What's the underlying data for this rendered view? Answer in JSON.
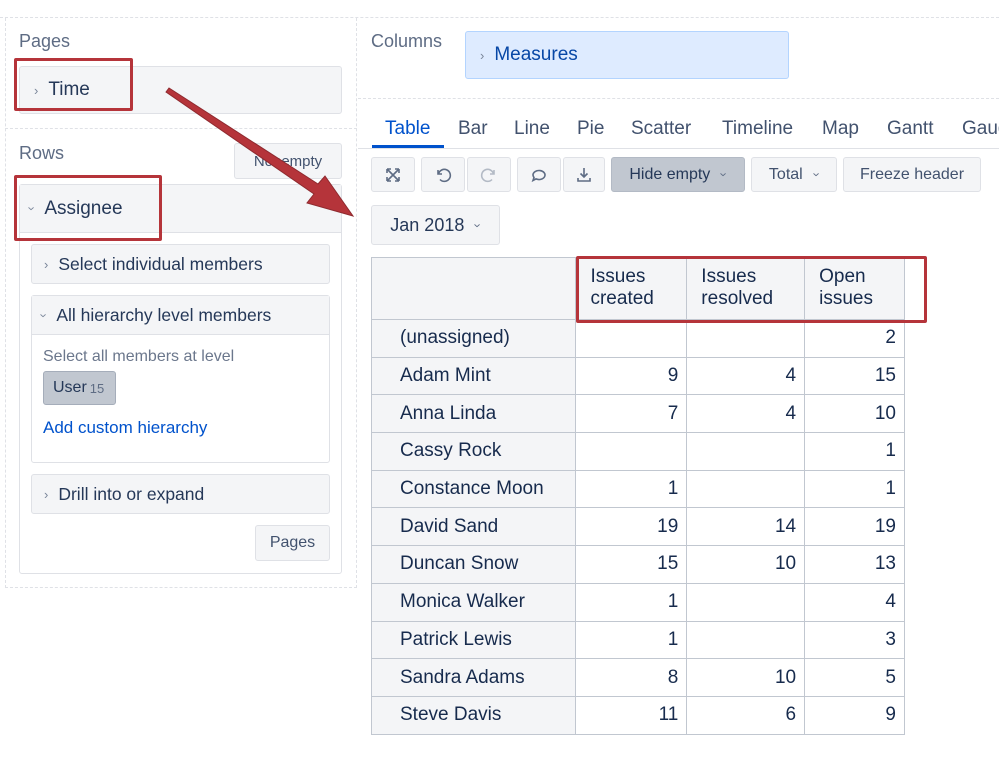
{
  "left": {
    "pages_label": "Pages",
    "time_item": "Time",
    "rows_label": "Rows",
    "nonempty_button": "Nonempty",
    "assignee_item": "Assignee",
    "select_individual": "Select individual members",
    "all_hierarchy": "All hierarchy level members",
    "select_all_level": "Select all members at level",
    "user_tag": "User",
    "user_count": "15",
    "add_custom": "Add custom hierarchy",
    "drill_expand": "Drill into or expand",
    "pages_button": "Pages"
  },
  "columns": {
    "label": "Columns",
    "measures": "Measures"
  },
  "tabs": [
    "Table",
    "Bar",
    "Line",
    "Pie",
    "Scatter",
    "Timeline",
    "Map",
    "Gantt",
    "Gaug"
  ],
  "toolbar": {
    "hide_empty": "Hide empty",
    "total": "Total",
    "freeze_header": "Freeze header"
  },
  "date_filter": "Jan 2018",
  "table": {
    "headers": [
      "Issues created",
      "Issues resolved",
      "Open issues"
    ],
    "rows": [
      {
        "name": "(unassigned)",
        "created": "",
        "resolved": "",
        "open": "2"
      },
      {
        "name": "Adam Mint",
        "created": "9",
        "resolved": "4",
        "open": "15"
      },
      {
        "name": "Anna Linda",
        "created": "7",
        "resolved": "4",
        "open": "10"
      },
      {
        "name": "Cassy Rock",
        "created": "",
        "resolved": "",
        "open": "1"
      },
      {
        "name": "Constance Moon",
        "created": "1",
        "resolved": "",
        "open": "1"
      },
      {
        "name": "David Sand",
        "created": "19",
        "resolved": "14",
        "open": "19"
      },
      {
        "name": "Duncan Snow",
        "created": "15",
        "resolved": "10",
        "open": "13"
      },
      {
        "name": "Monica Walker",
        "created": "1",
        "resolved": "",
        "open": "4"
      },
      {
        "name": "Patrick Lewis",
        "created": "1",
        "resolved": "",
        "open": "3"
      },
      {
        "name": "Sandra Adams",
        "created": "8",
        "resolved": "10",
        "open": "5"
      },
      {
        "name": "Steve Davis",
        "created": "11",
        "resolved": "6",
        "open": "9"
      }
    ]
  },
  "colors": {
    "annotation_red": "#b5343a",
    "link_blue": "#0052cc",
    "measures_bg": "#deebff"
  }
}
